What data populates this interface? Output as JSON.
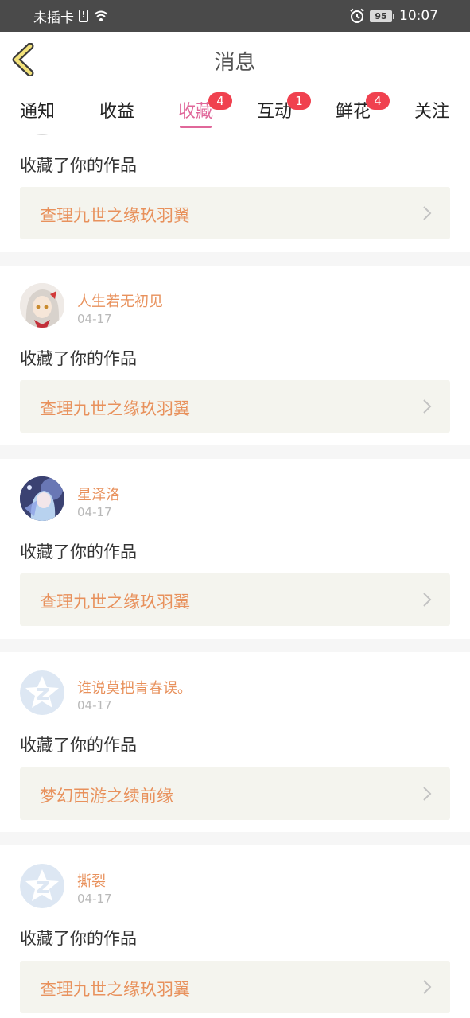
{
  "status_bar": {
    "carrier": "未插卡",
    "battery": "95",
    "time": "10:07"
  },
  "header": {
    "title": "消息"
  },
  "tabs": [
    {
      "label": "通知",
      "badge": ""
    },
    {
      "label": "收益",
      "badge": ""
    },
    {
      "label": "收藏",
      "badge": "4",
      "active": true
    },
    {
      "label": "互动",
      "badge": "1"
    },
    {
      "label": "鲜花",
      "badge": "4"
    },
    {
      "label": "关注",
      "badge": ""
    }
  ],
  "items": [
    {
      "user": "",
      "date": "",
      "action": "收藏了你的作品",
      "work": "查理九世之缘玖羽翼"
    },
    {
      "user": "人生若无初见",
      "date": "04-17",
      "action": "收藏了你的作品",
      "work": "查理九世之缘玖羽翼"
    },
    {
      "user": "星泽洛",
      "date": "04-17",
      "action": "收藏了你的作品",
      "work": "查理九世之缘玖羽翼"
    },
    {
      "user": "谁说莫把青春误。",
      "date": "04-17",
      "action": "收藏了你的作品",
      "work": "梦幻西游之续前缘"
    },
    {
      "user": "撕裂",
      "date": "04-17",
      "action": "收藏了你的作品",
      "work": "查理九世之缘玖羽翼"
    }
  ],
  "colors": {
    "accent": "#e0679a",
    "username": "#e8915c",
    "badge": "#f0414f"
  }
}
